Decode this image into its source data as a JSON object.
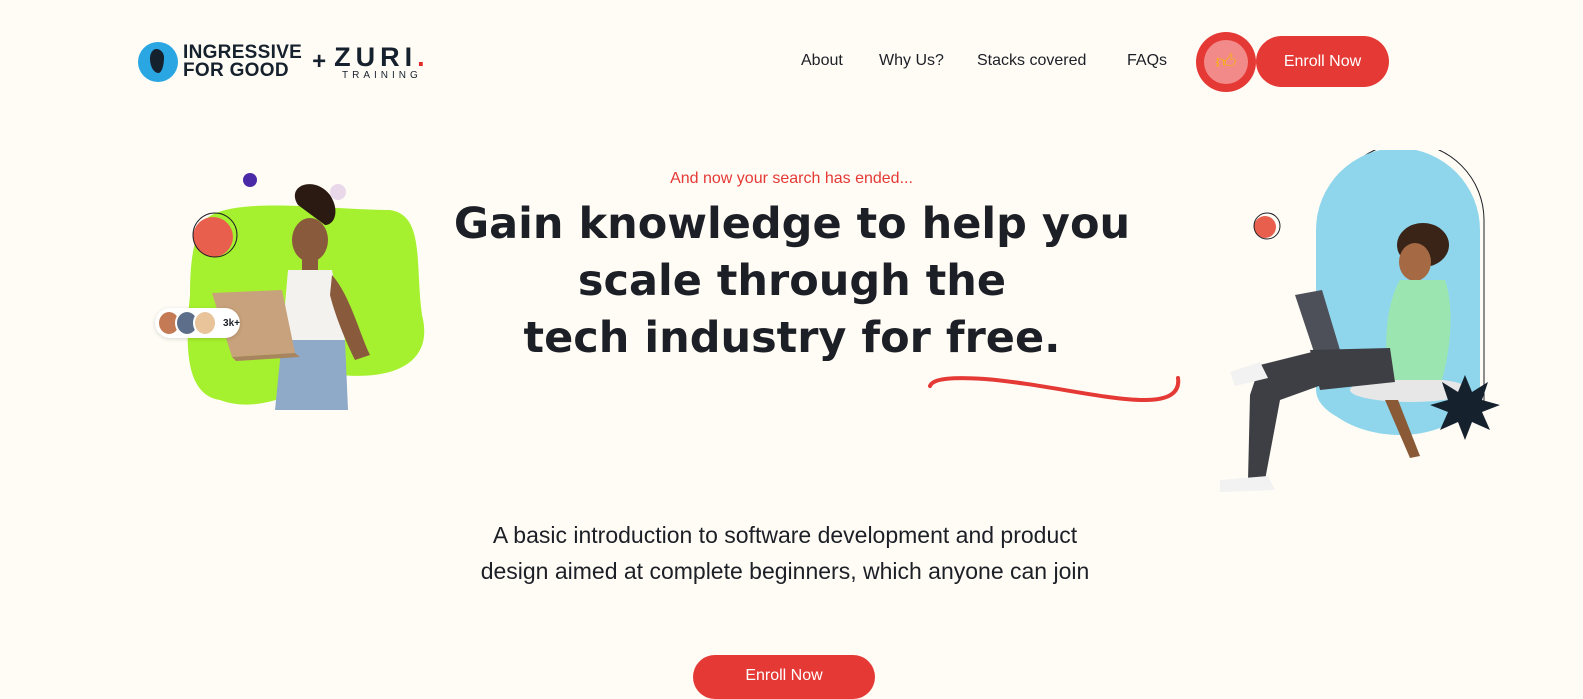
{
  "brand": {
    "partner_line1": "INGRESSIVE",
    "partner_line2": "FOR GOOD",
    "plus": "+",
    "zuri": "ZURI",
    "zuri_dot": ".",
    "zuri_sub": "TRAINING"
  },
  "nav": {
    "items": [
      {
        "label": "About"
      },
      {
        "label": "Why Us?"
      },
      {
        "label": "Stacks covered"
      },
      {
        "label": "FAQs"
      }
    ],
    "thumb_icon": "thumbs-up-icon",
    "enroll_label": "Enroll Now"
  },
  "hero": {
    "tagline": "And now your search has ended...",
    "headline_lines": [
      "Gain knowledge to help you",
      "scale through the",
      "tech industry for free."
    ],
    "description": "A basic introduction to software development and product design aimed at complete beginners, which anyone can join",
    "enroll_label": "Enroll Now",
    "learners_badge": "3k+"
  },
  "colors": {
    "background": "#fffcf5",
    "accent": "#e53935",
    "text": "#1c1f26",
    "blob_green": "#a6f12f",
    "pill_blue": "#8fd6ec"
  }
}
